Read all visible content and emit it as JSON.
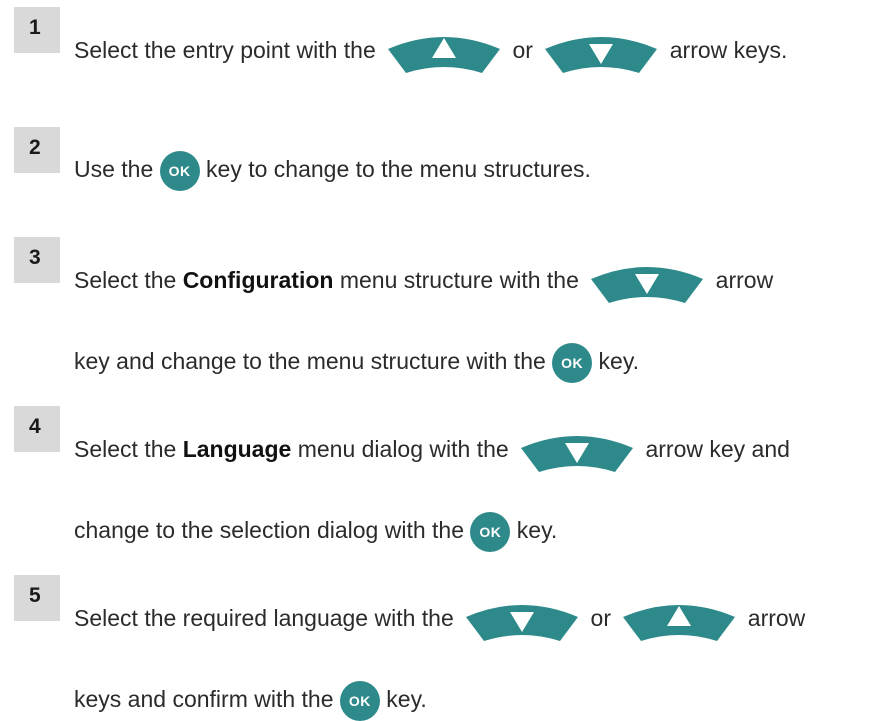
{
  "colors": {
    "key_teal": "#2e8a8a",
    "number_box": "#d9d9d9"
  },
  "icons": {
    "up": "arrow-up-key-icon",
    "down": "arrow-down-key-icon",
    "ok": "ok-key-icon"
  },
  "ok_label": "OK",
  "steps": [
    {
      "number": "1",
      "lines": [
        [
          "Select the entry point with the ",
          "{up}",
          " or ",
          "{down}",
          " arrow keys."
        ]
      ]
    },
    {
      "number": "2",
      "lines": [
        [
          "Use the ",
          "{ok}",
          " key to change to the menu structures."
        ]
      ]
    },
    {
      "number": "3",
      "lines": [
        [
          "Select the ",
          "**Configuration",
          " menu structure with the ",
          "{down}",
          " arrow"
        ],
        [
          "key and change to the menu structure with the ",
          "{ok}",
          " key."
        ]
      ]
    },
    {
      "number": "4",
      "lines": [
        [
          "Select the ",
          "**Language",
          " menu dialog with the ",
          "{down}",
          " arrow key and"
        ],
        [
          "change to the selection dialog with the ",
          "{ok}",
          " key."
        ]
      ]
    },
    {
      "number": "5",
      "lines": [
        [
          "Select the required language with the ",
          "{down}",
          " or ",
          "{up}",
          " arrow"
        ],
        [
          "keys and confirm with the ",
          "{ok}",
          " key."
        ]
      ]
    }
  ]
}
